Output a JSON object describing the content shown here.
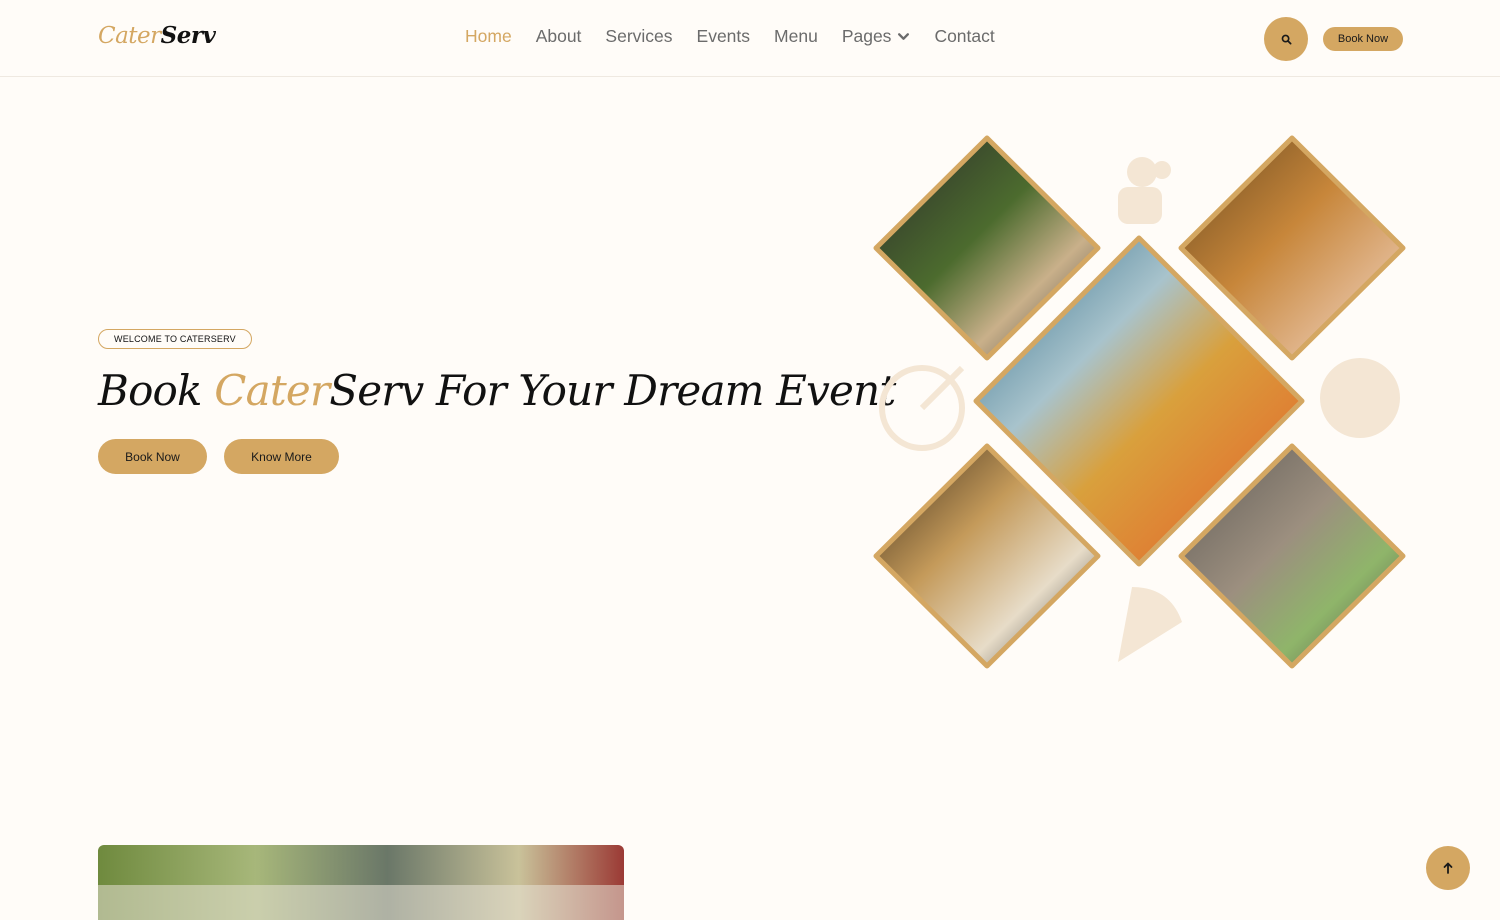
{
  "brand": {
    "part1": "Cater",
    "part2": "Serv"
  },
  "nav": {
    "items": [
      {
        "label": "Home",
        "active": true
      },
      {
        "label": "About"
      },
      {
        "label": "Services"
      },
      {
        "label": "Events"
      },
      {
        "label": "Menu"
      },
      {
        "label": "Pages",
        "has_dropdown": true
      },
      {
        "label": "Contact"
      }
    ],
    "search_icon": "search-icon",
    "book_label": "Book Now"
  },
  "hero": {
    "badge": "WELCOME TO CATERSERV",
    "headline_before": "Book ",
    "headline_highlight": "Cater",
    "headline_after": "Serv For Your Dream Event",
    "book_label": "Book Now",
    "know_label": "Know More"
  },
  "colors": {
    "accent": "#d4a762",
    "background": "#fffcf8",
    "text": "#111111",
    "nav_text": "#6b6b6b"
  },
  "back_to_top_icon": "arrow-up-icon"
}
